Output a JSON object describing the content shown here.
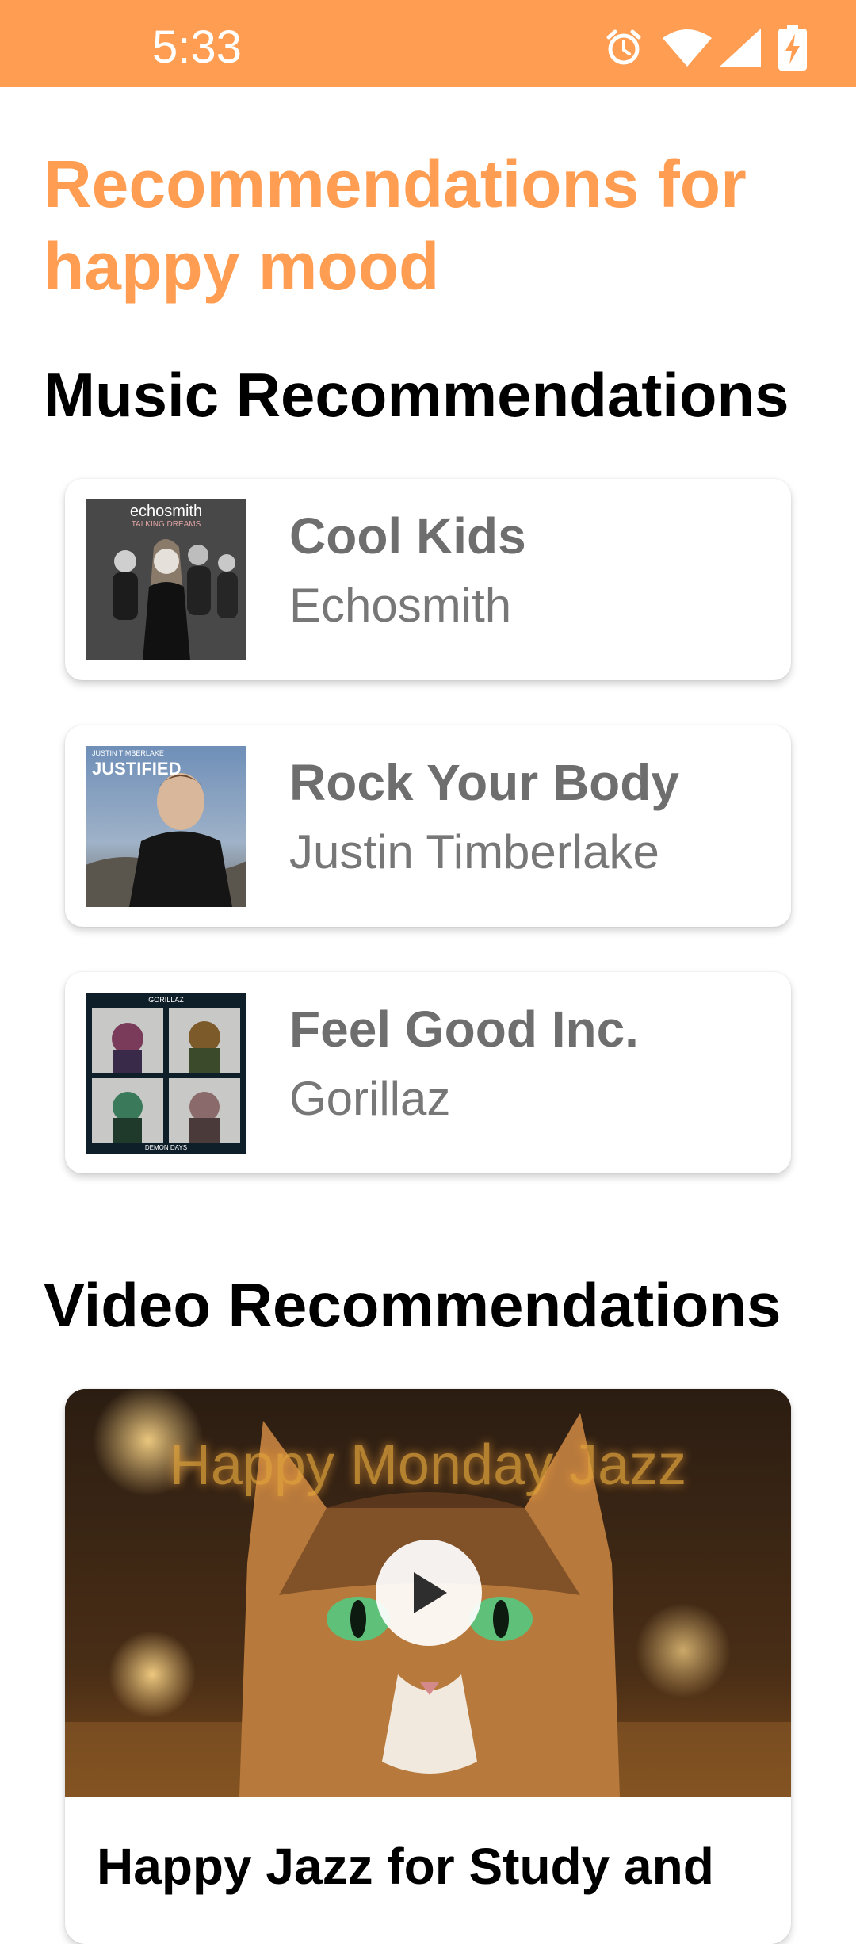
{
  "status_bar": {
    "time": "5:33",
    "icons": [
      "alarm-icon",
      "wifi-icon",
      "signal-icon",
      "battery-charging-icon"
    ],
    "background": "#ff9e52"
  },
  "page": {
    "title": "Recommendations for happy mood",
    "accent_color": "#ff9e52"
  },
  "music": {
    "section_title": "Music Recommendations",
    "items": [
      {
        "title": "Cool Kids",
        "artist": "Echosmith",
        "art": "album-art-talking-dreams",
        "art_text": [
          "echosmith",
          "TALKING DREAMS"
        ]
      },
      {
        "title": "Rock Your Body",
        "artist": "Justin Timberlake",
        "art": "album-art-justified",
        "art_text": [
          "JUSTIN TIMBERLAKE",
          "JUSTIFIED"
        ]
      },
      {
        "title": "Feel Good Inc.",
        "artist": "Gorillaz",
        "art": "album-art-demon-days",
        "art_text": [
          "GORILLAZ",
          "DEMON DAYS"
        ]
      }
    ]
  },
  "video": {
    "section_title": "Video Recommendations",
    "items": [
      {
        "thumbnail_text": "Happy Monday Jazz",
        "title": "Happy Jazz for Study and"
      }
    ]
  }
}
